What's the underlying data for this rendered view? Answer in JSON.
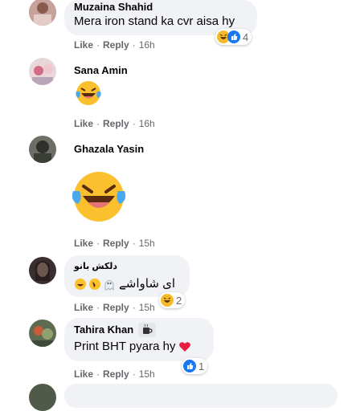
{
  "comments": [
    {
      "author": "Muzaina Shahid",
      "text": "Mera iron stand ka cvr aisa hy",
      "actions": {
        "like": "Like",
        "reply": "Reply",
        "time": "16h"
      },
      "reactions": {
        "icons": [
          "haha-icon",
          "like-icon"
        ],
        "count": "4"
      }
    },
    {
      "author": "Sana Amin",
      "emoji": "laughing-tears-emoji",
      "actions": {
        "like": "Like",
        "reply": "Reply",
        "time": "16h"
      }
    },
    {
      "author": "Ghazala Yasin",
      "emoji": "laughing-tears-emoji-large",
      "actions": {
        "like": "Like",
        "reply": "Reply",
        "time": "15h"
      }
    },
    {
      "author": "دلکش بانو",
      "text": "ای شاواشے",
      "inline_emojis": [
        "ghost-emoji",
        "rolling-laugh-emoji",
        "laughing-tears-emoji"
      ],
      "actions": {
        "like": "Like",
        "reply": "Reply",
        "time": "15h"
      },
      "reactions": {
        "icons": [
          "haha-icon"
        ],
        "count": "2"
      }
    },
    {
      "author": "Tahira Khan",
      "author_badge": "coffee-cup-icon",
      "text": "Print BHT pyara hy",
      "text_emoji": "red-heart-emoji",
      "actions": {
        "like": "Like",
        "reply": "Reply",
        "time": "15h"
      },
      "reactions": {
        "icons": [
          "like-icon"
        ],
        "count": "1"
      }
    }
  ],
  "colors": {
    "bubble": "#f0f2f5",
    "meta": "#65676b",
    "like_blue": "#1877f2",
    "haha_yellow": "#f7b928",
    "heart_red": "#e41e3f"
  }
}
